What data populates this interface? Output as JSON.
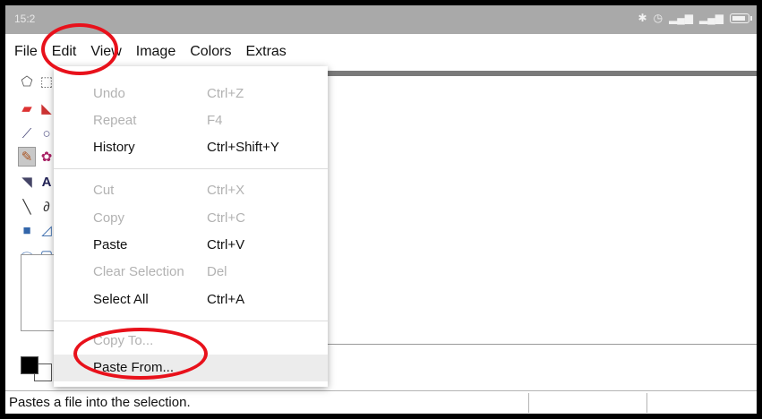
{
  "status_bar": {
    "time": "15:2",
    "icons": [
      "bluetooth-icon",
      "alarm-icon",
      "signal-icon",
      "signal-icon",
      "battery-icon"
    ]
  },
  "menubar": {
    "items": [
      "File",
      "Edit",
      "View",
      "Image",
      "Colors",
      "Extras"
    ]
  },
  "edit_menu": {
    "undo": {
      "label": "Undo",
      "shortcut": "Ctrl+Z"
    },
    "repeat": {
      "label": "Repeat",
      "shortcut": "F4"
    },
    "history": {
      "label": "History",
      "shortcut": "Ctrl+Shift+Y"
    },
    "cut": {
      "label": "Cut",
      "shortcut": "Ctrl+X"
    },
    "copy": {
      "label": "Copy",
      "shortcut": "Ctrl+C"
    },
    "paste": {
      "label": "Paste",
      "shortcut": "Ctrl+V"
    },
    "clear_selection": {
      "label": "Clear Selection",
      "shortcut": "Del"
    },
    "select_all": {
      "label": "Select All",
      "shortcut": "Ctrl+A"
    },
    "copy_to": {
      "label": "Copy To..."
    },
    "paste_from": {
      "label": "Paste From..."
    }
  },
  "status": {
    "text": "Pastes a file into the selection."
  },
  "colors": {
    "primary": "#000000",
    "secondary": "#ffffff",
    "annotation": "#e8111b",
    "statusbar": "#a9a9a9"
  }
}
